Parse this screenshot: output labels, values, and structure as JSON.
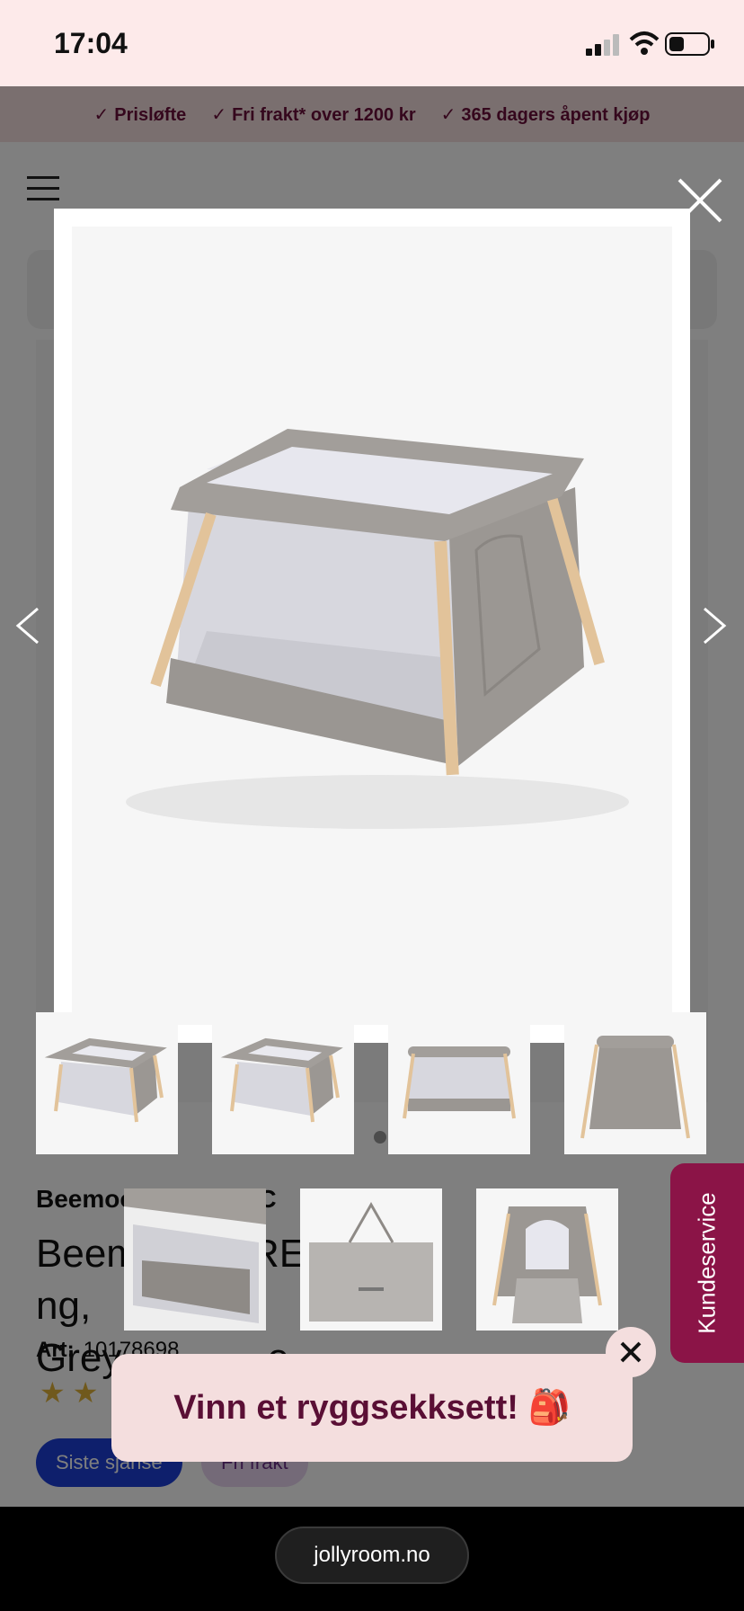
{
  "status_bar": {
    "time": "17:04"
  },
  "usp": [
    {
      "check": "✓",
      "label": "Prisløfte"
    },
    {
      "check": "✓",
      "label": "Fri frakt* over 1200 kr"
    },
    {
      "check": "✓",
      "label": "365 dagers åpent kjøp"
    }
  ],
  "product": {
    "brand": "Beemoo",
    "brand_suffix": "o C",
    "title_part1": "Beem",
    "title_part2": "RE",
    "title_part3": "e",
    "title_part4": "ng,",
    "title_line2_part1": "Grey",
    "title_line2_part2": "e",
    "art_label": "Art:",
    "art_number": "10178698",
    "stars": "★★"
  },
  "tags": {
    "sale": "Siste sjanse",
    "free_shipping": "Fri frakt"
  },
  "customer_service": "Kundeservice",
  "promo": {
    "text": "Vinn et ryggsekksett!",
    "emoji": "🎒"
  },
  "browser": {
    "url": "jollyroom.no"
  },
  "colors": {
    "brand": "#8b1447",
    "usp_text": "#6b0f3a",
    "sale_tag": "#1c3fd8"
  }
}
